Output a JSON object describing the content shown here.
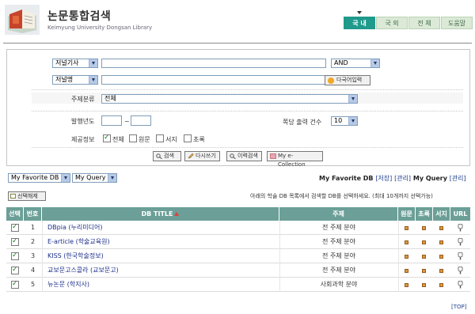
{
  "header": {
    "title": "논문통합검색",
    "subtitle": "Keimyung University Dongsan Library",
    "tabs": [
      "국 내",
      "국 외",
      "전 체",
      "도움말"
    ],
    "active_tab": 0
  },
  "search": {
    "field1": "저널기사",
    "operator": "AND",
    "field2": "저널명",
    "multilang_button": "다국어입력",
    "subject_label": "주제분류",
    "subject_value": "전체",
    "year_label": "발행년도",
    "year_sep": "~",
    "per_page_label": "쪽당 출력 건수",
    "per_page_value": "10",
    "info_label": "제공정보",
    "checkboxes": [
      {
        "label": "전체",
        "checked": true
      },
      {
        "label": "원문",
        "checked": false
      },
      {
        "label": "서지",
        "checked": false
      },
      {
        "label": "초록",
        "checked": false
      }
    ],
    "buttons": {
      "search": "검색",
      "reset": "다시쓰기",
      "history": "이력검색",
      "collection": "My e-Collection"
    }
  },
  "favorites": {
    "fav_db_select": "My Favorite DB",
    "query_select": "My Query",
    "right_text_1": "My Favorite DB",
    "link_save": "[저장]",
    "link_manage1": "[관리]",
    "right_text_2": "My Query",
    "link_manage2": "[관리]",
    "select_button": "선택해제",
    "notice": "아래의 학술 DB 목록에서 검색할 DB를 선택하세요. (최대 10개까지 선택가능)"
  },
  "table": {
    "headers": [
      "선택",
      "번호",
      "DB TITLE",
      "주제",
      "원문",
      "초록",
      "서지",
      "URL"
    ],
    "rows": [
      {
        "num": "1",
        "title": "DBpia (누리미디어)",
        "subject": "전 주제 분야",
        "checked": true
      },
      {
        "num": "2",
        "title": "E-article (학술교육원)",
        "subject": "전 주제 분야",
        "checked": true
      },
      {
        "num": "3",
        "title": "KISS (한국학술정보)",
        "subject": "전 주제 분야",
        "checked": true
      },
      {
        "num": "4",
        "title": "교보문고스콜라 (교보문고)",
        "subject": "전 주제 분야",
        "checked": true
      },
      {
        "num": "5",
        "title": "뉴논문 (학지사)",
        "subject": "사회과학 분야",
        "checked": true
      }
    ]
  },
  "footer": {
    "top_link": "[TOP]"
  },
  "colors": {
    "accent": "#1f9a8c",
    "table_header": "#6b9f97",
    "link": "#1d2f8a"
  }
}
